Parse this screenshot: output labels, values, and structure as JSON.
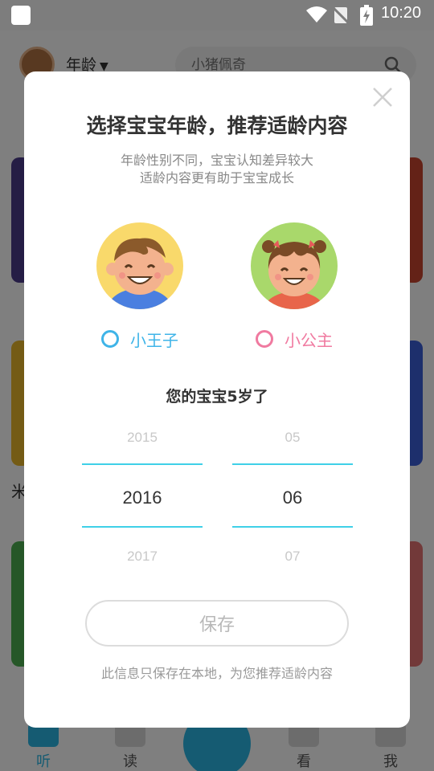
{
  "status_bar": {
    "time": "10:20"
  },
  "app": {
    "header": {
      "age_filter_label": "年龄",
      "search_placeholder": "小猪佩奇"
    },
    "partial_text": {
      "left_fragment": "米"
    },
    "tabs": [
      {
        "label": "听",
        "active": true,
        "icon": "listen-icon"
      },
      {
        "label": "读",
        "active": false,
        "icon": "read-icon"
      },
      {
        "label": "看",
        "active": false,
        "icon": "watch-icon"
      },
      {
        "label": "我",
        "active": false,
        "icon": "me-icon"
      }
    ]
  },
  "dialog": {
    "title": "选择宝宝年龄，推荐适龄内容",
    "subtitle_line1": "年龄性别不同，宝宝认知差异较大",
    "subtitle_line2": "适龄内容更有助于宝宝成长",
    "gender_options": [
      {
        "label": "小王子",
        "icon": "boy-avatar-icon",
        "color": "#3fb4e8"
      },
      {
        "label": "小公主",
        "icon": "girl-avatar-icon",
        "color": "#f07aa0"
      }
    ],
    "age_text": "您的宝宝5岁了",
    "year_picker": {
      "prev": "2015",
      "selected": "2016",
      "next": "2017"
    },
    "month_picker": {
      "prev": "05",
      "selected": "06",
      "next": "07"
    },
    "save_label": "保存",
    "footnote": "此信息只保存在本地，为您推荐适龄内容"
  },
  "colors": {
    "accent_blue": "#2ab7e5",
    "picker_line": "#3fd0e8",
    "girl_pink": "#f07aa0"
  }
}
